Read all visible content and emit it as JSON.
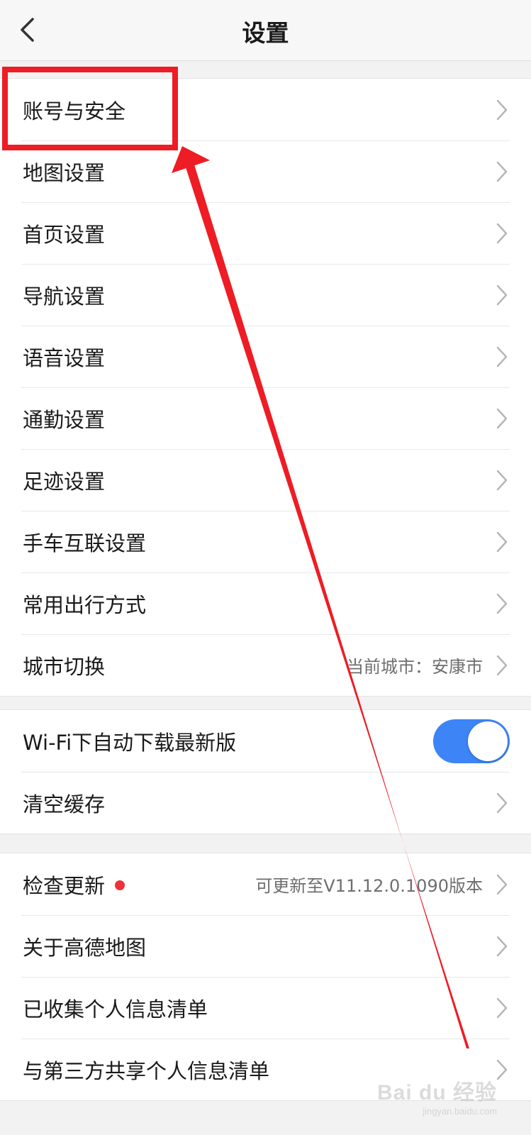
{
  "header": {
    "title": "设置",
    "back_icon": "chevron-left-icon"
  },
  "group1": [
    {
      "name": "account-security",
      "label": "账号与安全",
      "value": ""
    },
    {
      "name": "map-settings",
      "label": "地图设置",
      "value": ""
    },
    {
      "name": "home-settings",
      "label": "首页设置",
      "value": ""
    },
    {
      "name": "navigation-settings",
      "label": "导航设置",
      "value": ""
    },
    {
      "name": "voice-settings",
      "label": "语音设置",
      "value": ""
    },
    {
      "name": "commute-settings",
      "label": "通勤设置",
      "value": ""
    },
    {
      "name": "footprint-settings",
      "label": "足迹设置",
      "value": ""
    },
    {
      "name": "phone-car-settings",
      "label": "手车互联设置",
      "value": ""
    },
    {
      "name": "travel-mode",
      "label": "常用出行方式",
      "value": ""
    },
    {
      "name": "city-switch",
      "label": "城市切换",
      "value": "当前城市：安康市"
    }
  ],
  "group2": {
    "wifi_download": {
      "label": "Wi-Fi下自动下载最新版",
      "enabled": true
    },
    "clear_cache": {
      "label": "清空缓存"
    }
  },
  "group3": [
    {
      "name": "check-update",
      "label": "检查更新",
      "value": "可更新至V11.12.0.1090版本",
      "badge": true
    },
    {
      "name": "about",
      "label": "关于高德地图",
      "value": ""
    },
    {
      "name": "collected-info",
      "label": "已收集个人信息清单",
      "value": ""
    },
    {
      "name": "shared-info",
      "label": "与第三方共享个人信息清单",
      "value": ""
    }
  ],
  "colors": {
    "accent": "#3d84f6",
    "annotation": "#ee1c24",
    "badge": "#f0313a"
  },
  "watermark": {
    "logo": "Bai du 经验",
    "url": "jingyan.baidu.com"
  }
}
